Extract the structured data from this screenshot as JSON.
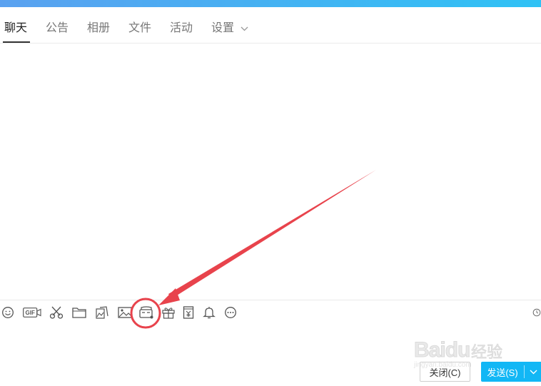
{
  "tabs": [
    {
      "label": "聊天",
      "active": true
    },
    {
      "label": "公告"
    },
    {
      "label": "相册"
    },
    {
      "label": "文件"
    },
    {
      "label": "活动"
    },
    {
      "label": "设置"
    }
  ],
  "toolbar": {
    "icons": [
      "emoji-icon",
      "gif-icon",
      "scissors-icon",
      "folder-icon",
      "image-gallery-icon",
      "image-icon",
      "screen-share-icon",
      "gift-icon",
      "red-packet-icon",
      "bell-icon",
      "more-icon",
      "history-icon"
    ],
    "gif_text": "GIF"
  },
  "buttons": {
    "close_label": "关闭(C)",
    "send_label": "发送(S)"
  },
  "watermark": {
    "brand": "Bai",
    "brand2": "du",
    "sub": "经验",
    "url": "jingyan.baidu.com"
  },
  "colors": {
    "accent": "#12b7f5",
    "annotation": "#e8434c",
    "topbar_start": "#5aa1f0",
    "topbar_end": "#2fc2f5"
  }
}
